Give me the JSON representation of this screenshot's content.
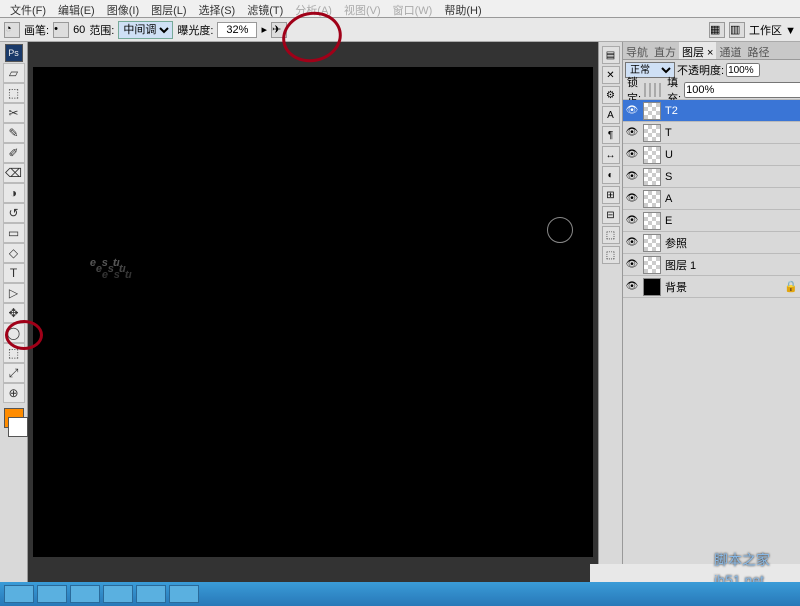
{
  "menu": [
    "文件(F)",
    "编辑(E)",
    "图像(I)",
    "图层(L)",
    "选择(S)",
    "滤镜(T)",
    "分析(A)",
    "视图(V)",
    "窗口(W)",
    "帮助(H)"
  ],
  "menuDim": [
    false,
    false,
    false,
    false,
    false,
    false,
    true,
    true,
    true,
    false
  ],
  "options": {
    "brushLabel": "画笔:",
    "brushSize": "60",
    "rangeLabel": "范围:",
    "rangeValue": "中间调",
    "exposureLabel": "曝光度:",
    "exposureValue": "32%",
    "workspaceLabel": "工作区 ▼"
  },
  "canvasText": {
    "first": "t",
    "rest": "use"
  },
  "panelTabs": [
    "导航",
    "直方",
    "图层 ×",
    "通道",
    "路径"
  ],
  "activeTab": 2,
  "blend": {
    "modeLabel": "正常",
    "opacityLabel": "不透明度:",
    "opacityVal": "100%",
    "fillLabel": "填充:",
    "fillVal": "100%",
    "lockLabel": "锁定:"
  },
  "layers": [
    {
      "name": "T2",
      "sel": true,
      "thumb": "check"
    },
    {
      "name": "T",
      "sel": false,
      "thumb": "check"
    },
    {
      "name": "U",
      "sel": false,
      "thumb": "check"
    },
    {
      "name": "S",
      "sel": false,
      "thumb": "check"
    },
    {
      "name": "A",
      "sel": false,
      "thumb": "check"
    },
    {
      "name": "E",
      "sel": false,
      "thumb": "check"
    },
    {
      "name": "参照",
      "sel": false,
      "thumb": "check"
    },
    {
      "name": "图层 1",
      "sel": false,
      "thumb": "check"
    },
    {
      "name": "背景",
      "sel": false,
      "thumb": "black",
      "lock": true
    }
  ],
  "tools": [
    "▱",
    "⬚",
    "✂",
    "✎",
    "✐",
    "⌫",
    "◑",
    "↺",
    "▭",
    "◇",
    "T",
    "▷",
    "✥",
    "◯",
    "⬚",
    "⤢",
    "⊕"
  ],
  "dockIcons": [
    "▤",
    "✕",
    "⚙",
    "A",
    "¶",
    "↔",
    "◐",
    "⊞",
    "⊟",
    "⬚",
    "⬚"
  ],
  "watermark1": "脚本之家",
  "watermark2": "jb51.net",
  "appIcon": "Ps"
}
